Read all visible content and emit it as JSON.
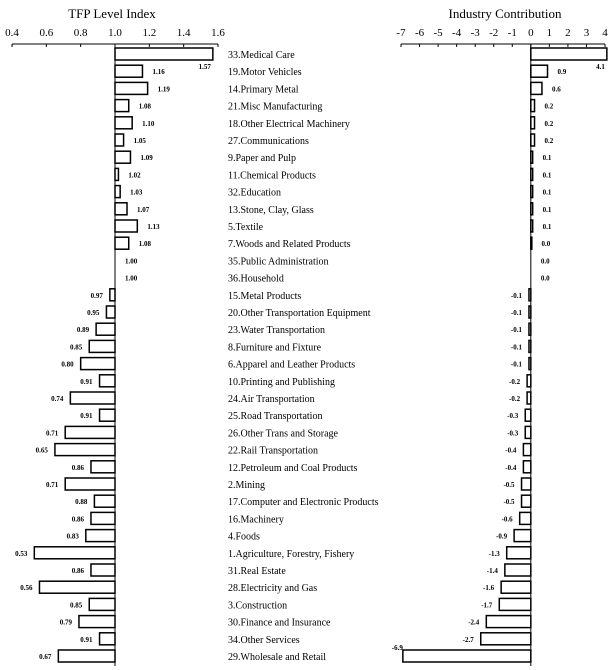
{
  "chart_data": [
    {
      "type": "bar",
      "orientation": "horizontal",
      "title": "TFP Level Index",
      "baseline": 1.0,
      "xlim": [
        0.4,
        1.6
      ],
      "xticks": [
        "0.4",
        "0.6",
        "0.8",
        "1.0",
        "1.2",
        "1.4",
        "1.6"
      ],
      "categories": [
        "33.Medical Care",
        "19.Motor Vehicles",
        "14.Primary Metal",
        "21.Misc Manufacturing",
        "18.Other Electrical Machinery",
        "27.Communications",
        "9.Paper and Pulp",
        "11.Chemical Products",
        "32.Education",
        "13.Stone, Clay, Glass",
        "5.Textile",
        "7.Woods and Related Products",
        "35.Public Administration",
        "36.Household",
        "15.Metal Products",
        "20.Other Transportation Equipment",
        "23.Water Transportation",
        "8.Furniture and Fixture",
        "6.Apparel and Leather Products",
        "10.Printing and Publishing",
        "24.Air Transportation",
        "25.Road Transportation",
        "26.Other Trans and Storage",
        "22.Rail Transportation",
        "12.Petroleum and Coal Products",
        "2.Mining",
        "17.Computer and Electronic Products",
        "16.Machinery",
        "4.Foods",
        "1.Agriculture, Forestry, Fishery",
        "31.Real Estate",
        "28.Electricity and Gas",
        "3.Construction",
        "30.Finance and Insurance",
        "34.Other Services",
        "29.Wholesale and Retail"
      ],
      "values": [
        1.57,
        1.16,
        1.19,
        1.08,
        1.1,
        1.05,
        1.09,
        1.02,
        1.03,
        1.07,
        1.13,
        1.08,
        1.0,
        1.0,
        0.97,
        0.95,
        0.89,
        0.85,
        0.8,
        0.91,
        0.74,
        0.91,
        0.71,
        0.65,
        0.86,
        0.71,
        0.88,
        0.86,
        0.83,
        0.53,
        0.86,
        0.56,
        0.85,
        0.79,
        0.91,
        0.67
      ],
      "labels": [
        "1.57",
        "1.16",
        "1.19",
        "1.08",
        "1.10",
        "1.05",
        "1.09",
        "1.02",
        "1.03",
        "1.07",
        "1.13",
        "1.08",
        "1.00",
        "1.00",
        "0.97",
        "0.95",
        "0.89",
        "0.85",
        "0.80",
        "0.91",
        "0.74",
        "0.91",
        "0.71",
        "0.65",
        "0.86",
        "0.71",
        "0.88",
        "0.86",
        "0.83",
        "0.53",
        "0.86",
        "0.56",
        "0.85",
        "0.79",
        "0.91",
        "0.67"
      ]
    },
    {
      "type": "bar",
      "orientation": "horizontal",
      "title": "Industry Contribution",
      "baseline": 0,
      "xlim": [
        -7,
        4
      ],
      "xticks": [
        "-7",
        "-6",
        "-5",
        "-4",
        "-3",
        "-2",
        "-1",
        "0",
        "1",
        "2",
        "3",
        "4"
      ],
      "values": [
        4.1,
        0.9,
        0.6,
        0.2,
        0.2,
        0.2,
        0.1,
        0.1,
        0.1,
        0.1,
        0.1,
        0.04,
        0.0,
        0.0,
        -0.1,
        -0.1,
        -0.1,
        -0.1,
        -0.1,
        -0.2,
        -0.2,
        -0.3,
        -0.3,
        -0.4,
        -0.4,
        -0.5,
        -0.5,
        -0.6,
        -0.9,
        -1.3,
        -1.4,
        -1.6,
        -1.7,
        -2.4,
        -2.7,
        -6.9
      ],
      "labels": [
        "4.1",
        "0.9",
        "0.6",
        "0.2",
        "0.2",
        "0.2",
        "0.1",
        "0.1",
        "0.1",
        "0.1",
        "0.1",
        "0.0",
        "0.0",
        "0.0",
        "-0.1",
        "-0.1",
        "-0.1",
        "-0.1",
        "-0.1",
        "-0.2",
        "-0.2",
        "-0.3",
        "-0.3",
        "-0.4",
        "-0.4",
        "-0.5",
        "-0.5",
        "-0.6",
        "-0.9",
        "-1.3",
        "-1.4",
        "-1.6",
        "-1.7",
        "-2.4",
        "-2.7",
        "-6.9"
      ]
    }
  ]
}
